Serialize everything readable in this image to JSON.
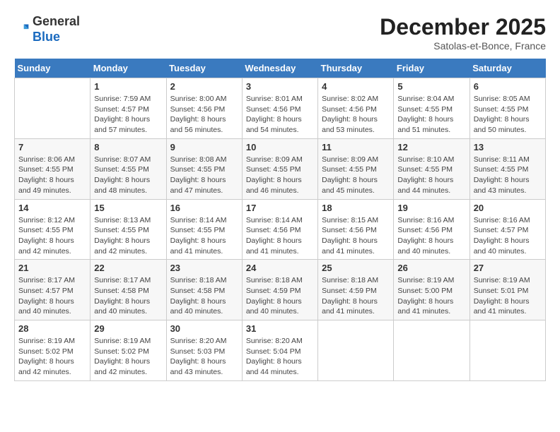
{
  "logo": {
    "general": "General",
    "blue": "Blue"
  },
  "header": {
    "month": "December 2025",
    "location": "Satolas-et-Bonce, France"
  },
  "weekdays": [
    "Sunday",
    "Monday",
    "Tuesday",
    "Wednesday",
    "Thursday",
    "Friday",
    "Saturday"
  ],
  "weeks": [
    [
      {
        "day": "",
        "info": ""
      },
      {
        "day": "1",
        "info": "Sunrise: 7:59 AM\nSunset: 4:57 PM\nDaylight: 8 hours\nand 57 minutes."
      },
      {
        "day": "2",
        "info": "Sunrise: 8:00 AM\nSunset: 4:56 PM\nDaylight: 8 hours\nand 56 minutes."
      },
      {
        "day": "3",
        "info": "Sunrise: 8:01 AM\nSunset: 4:56 PM\nDaylight: 8 hours\nand 54 minutes."
      },
      {
        "day": "4",
        "info": "Sunrise: 8:02 AM\nSunset: 4:56 PM\nDaylight: 8 hours\nand 53 minutes."
      },
      {
        "day": "5",
        "info": "Sunrise: 8:04 AM\nSunset: 4:55 PM\nDaylight: 8 hours\nand 51 minutes."
      },
      {
        "day": "6",
        "info": "Sunrise: 8:05 AM\nSunset: 4:55 PM\nDaylight: 8 hours\nand 50 minutes."
      }
    ],
    [
      {
        "day": "7",
        "info": "Sunrise: 8:06 AM\nSunset: 4:55 PM\nDaylight: 8 hours\nand 49 minutes."
      },
      {
        "day": "8",
        "info": "Sunrise: 8:07 AM\nSunset: 4:55 PM\nDaylight: 8 hours\nand 48 minutes."
      },
      {
        "day": "9",
        "info": "Sunrise: 8:08 AM\nSunset: 4:55 PM\nDaylight: 8 hours\nand 47 minutes."
      },
      {
        "day": "10",
        "info": "Sunrise: 8:09 AM\nSunset: 4:55 PM\nDaylight: 8 hours\nand 46 minutes."
      },
      {
        "day": "11",
        "info": "Sunrise: 8:09 AM\nSunset: 4:55 PM\nDaylight: 8 hours\nand 45 minutes."
      },
      {
        "day": "12",
        "info": "Sunrise: 8:10 AM\nSunset: 4:55 PM\nDaylight: 8 hours\nand 44 minutes."
      },
      {
        "day": "13",
        "info": "Sunrise: 8:11 AM\nSunset: 4:55 PM\nDaylight: 8 hours\nand 43 minutes."
      }
    ],
    [
      {
        "day": "14",
        "info": "Sunrise: 8:12 AM\nSunset: 4:55 PM\nDaylight: 8 hours\nand 42 minutes."
      },
      {
        "day": "15",
        "info": "Sunrise: 8:13 AM\nSunset: 4:55 PM\nDaylight: 8 hours\nand 42 minutes."
      },
      {
        "day": "16",
        "info": "Sunrise: 8:14 AM\nSunset: 4:55 PM\nDaylight: 8 hours\nand 41 minutes."
      },
      {
        "day": "17",
        "info": "Sunrise: 8:14 AM\nSunset: 4:56 PM\nDaylight: 8 hours\nand 41 minutes."
      },
      {
        "day": "18",
        "info": "Sunrise: 8:15 AM\nSunset: 4:56 PM\nDaylight: 8 hours\nand 41 minutes."
      },
      {
        "day": "19",
        "info": "Sunrise: 8:16 AM\nSunset: 4:56 PM\nDaylight: 8 hours\nand 40 minutes."
      },
      {
        "day": "20",
        "info": "Sunrise: 8:16 AM\nSunset: 4:57 PM\nDaylight: 8 hours\nand 40 minutes."
      }
    ],
    [
      {
        "day": "21",
        "info": "Sunrise: 8:17 AM\nSunset: 4:57 PM\nDaylight: 8 hours\nand 40 minutes."
      },
      {
        "day": "22",
        "info": "Sunrise: 8:17 AM\nSunset: 4:58 PM\nDaylight: 8 hours\nand 40 minutes."
      },
      {
        "day": "23",
        "info": "Sunrise: 8:18 AM\nSunset: 4:58 PM\nDaylight: 8 hours\nand 40 minutes."
      },
      {
        "day": "24",
        "info": "Sunrise: 8:18 AM\nSunset: 4:59 PM\nDaylight: 8 hours\nand 40 minutes."
      },
      {
        "day": "25",
        "info": "Sunrise: 8:18 AM\nSunset: 4:59 PM\nDaylight: 8 hours\nand 41 minutes."
      },
      {
        "day": "26",
        "info": "Sunrise: 8:19 AM\nSunset: 5:00 PM\nDaylight: 8 hours\nand 41 minutes."
      },
      {
        "day": "27",
        "info": "Sunrise: 8:19 AM\nSunset: 5:01 PM\nDaylight: 8 hours\nand 41 minutes."
      }
    ],
    [
      {
        "day": "28",
        "info": "Sunrise: 8:19 AM\nSunset: 5:02 PM\nDaylight: 8 hours\nand 42 minutes."
      },
      {
        "day": "29",
        "info": "Sunrise: 8:19 AM\nSunset: 5:02 PM\nDaylight: 8 hours\nand 42 minutes."
      },
      {
        "day": "30",
        "info": "Sunrise: 8:20 AM\nSunset: 5:03 PM\nDaylight: 8 hours\nand 43 minutes."
      },
      {
        "day": "31",
        "info": "Sunrise: 8:20 AM\nSunset: 5:04 PM\nDaylight: 8 hours\nand 44 minutes."
      },
      {
        "day": "",
        "info": ""
      },
      {
        "day": "",
        "info": ""
      },
      {
        "day": "",
        "info": ""
      }
    ]
  ]
}
